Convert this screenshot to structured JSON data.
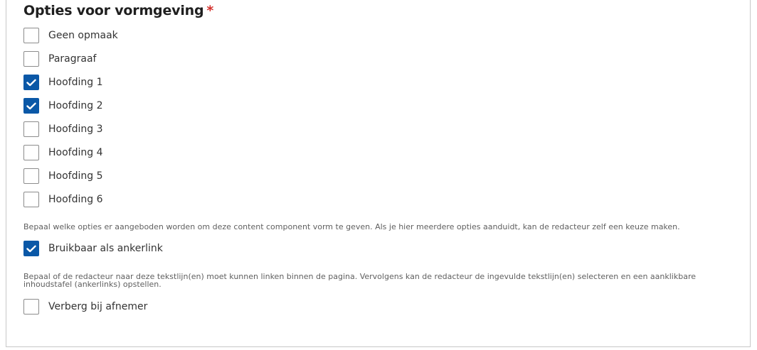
{
  "section": {
    "title": "Opties voor vormgeving",
    "required_mark": "*"
  },
  "format_options": [
    {
      "label": "Geen opmaak",
      "checked": false
    },
    {
      "label": "Paragraaf",
      "checked": false
    },
    {
      "label": "Hoofding 1",
      "checked": true
    },
    {
      "label": "Hoofding 2",
      "checked": true
    },
    {
      "label": "Hoofding 3",
      "checked": false
    },
    {
      "label": "Hoofding 4",
      "checked": false
    },
    {
      "label": "Hoofding 5",
      "checked": false
    },
    {
      "label": "Hoofding 6",
      "checked": false
    }
  ],
  "format_help": "Bepaal welke opties er aangeboden worden om deze content component vorm te geven. Als je hier meerdere opties aanduidt, kan de redacteur zelf een keuze maken.",
  "anchor": {
    "label": "Bruikbaar als ankerlink",
    "checked": true,
    "help": "Bepaal of de redacteur naar deze tekstlijn(en) moet kunnen linken binnen de pagina. Vervolgens kan de redacteur de ingevulde tekstlijn(en) selecteren en een aanklikbare inhoudstafel (ankerlinks) opstellen."
  },
  "hide": {
    "label": "Verberg bij afnemer",
    "checked": false
  },
  "colors": {
    "checkbox_checked": "#0a58a7",
    "required": "#d4312c"
  }
}
